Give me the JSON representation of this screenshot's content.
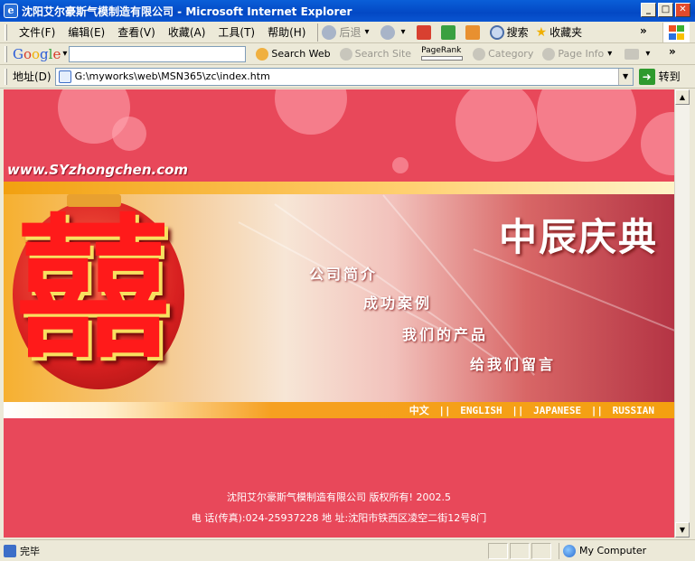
{
  "window": {
    "title": "沈阳艾尔豪斯气模制造有限公司 - Microsoft Internet Explorer",
    "minimize": "_",
    "maximize": "□",
    "close": "✕"
  },
  "menu": {
    "items": [
      "文件(F)",
      "编辑(E)",
      "查看(V)",
      "收藏(A)",
      "工具(T)",
      "帮助(H)"
    ],
    "back_label": "后退",
    "search_label": "搜索",
    "favorites_label": "收藏夹",
    "more": "»"
  },
  "google_toolbar": {
    "logo": "Google",
    "search_value": "",
    "search_web": "Search Web",
    "search_site": "Search Site",
    "pagerank": "PageRank",
    "category": "Category",
    "page_info": "Page Info",
    "more": "»"
  },
  "address": {
    "label": "地址(D)",
    "url": "G:\\myworks\\web\\MSN365\\zc\\index.htm",
    "go": "转到"
  },
  "page": {
    "site_url": "www.SYzhongchen.com",
    "brand": "中辰庆典",
    "xi": "囍",
    "nav": [
      "公司简介",
      "成功案例",
      "我们的产品",
      "给我们留言"
    ],
    "languages": [
      "中文",
      "ENGLISH",
      "JAPANESE",
      "RUSSIAN"
    ],
    "lang_sep": "||",
    "footer_copyright": "沈阳艾尔豪斯气模制造有限公司 版权所有!  2002.5",
    "footer_contact": "电 话(传真):024-25937228   地 址:沈阳市铁西区凌空二街12号8门"
  },
  "status": {
    "text": "完毕",
    "zone": "My Computer"
  },
  "colors": {
    "page_bg": "#e8485a",
    "banner_orange": "#f4a010",
    "xp_blue": "#0348c4"
  }
}
